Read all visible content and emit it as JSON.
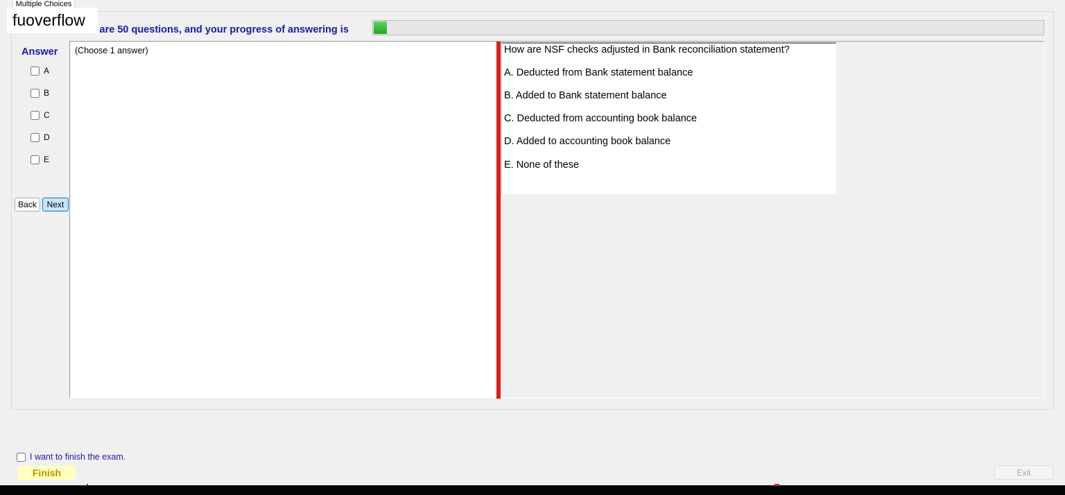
{
  "tab": {
    "label": "Multiple Choices"
  },
  "watermark": "fuoverflow",
  "progress": {
    "text": "There are 50 questions, and your progress of answering is",
    "fraction": 0.02,
    "color": "#27b327"
  },
  "answer_panel": {
    "title": "Answer",
    "options": [
      "A",
      "B",
      "C",
      "D",
      "E"
    ],
    "checked": [
      false,
      false,
      false,
      false,
      false
    ]
  },
  "nav": {
    "back_label": "Back",
    "next_label": "Next"
  },
  "hint": "(Choose 1 answer)",
  "question": {
    "text": "How are NSF checks adjusted in Bank reconciliation statement?",
    "choices": [
      "A.  Deducted from Bank statement balance",
      "B.  Added to Bank statement balance",
      "C.  Deducted from accounting book balance",
      "D.  Added to accounting book balance",
      "E.  None of these"
    ]
  },
  "footer": {
    "finish_check_label": "I want to finish the exam.",
    "finish_checked": false,
    "finish_label": "Finish",
    "exit_label": "Exit"
  },
  "colors": {
    "accent_text": "#1a1aa8",
    "divider": "#e01b1b",
    "finish_bg": "#ffffbf"
  }
}
